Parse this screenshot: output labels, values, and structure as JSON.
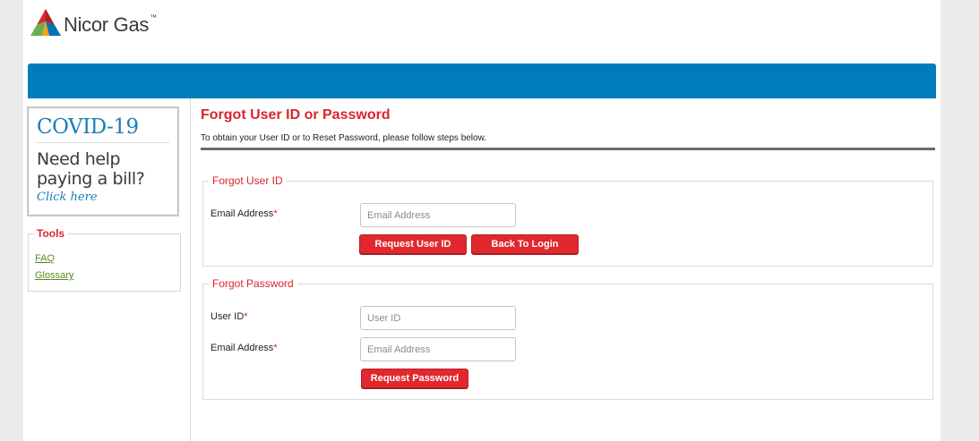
{
  "brand": {
    "name": "Nicor Gas",
    "trademark": "™",
    "colors": {
      "blue": "#007cba",
      "red": "#d9262c",
      "green": "#5a8a1f"
    }
  },
  "sidebar": {
    "covid_banner": {
      "title": "COVID-19",
      "line1": "Need help",
      "line2": "paying a bill?",
      "link": "Click here"
    },
    "tools": {
      "legend": "Tools",
      "links": [
        "FAQ",
        "Glossary"
      ]
    }
  },
  "main": {
    "title": "Forgot User ID or Password",
    "subtitle": "To obtain your User ID or to Reset Password, please follow steps below.",
    "forgot_user_id": {
      "legend": "Forgot User ID",
      "email_label": "Email Address",
      "required_mark": "*",
      "email_placeholder": "Email Address",
      "request_button": "Request User ID",
      "back_button": "Back To Login"
    },
    "forgot_password": {
      "legend": "Forgot Password",
      "userid_label": "User ID",
      "userid_placeholder": "User ID",
      "email_label": "Email Address",
      "email_placeholder": "Email Address",
      "required_mark": "*",
      "request_button": "Request Password"
    }
  }
}
